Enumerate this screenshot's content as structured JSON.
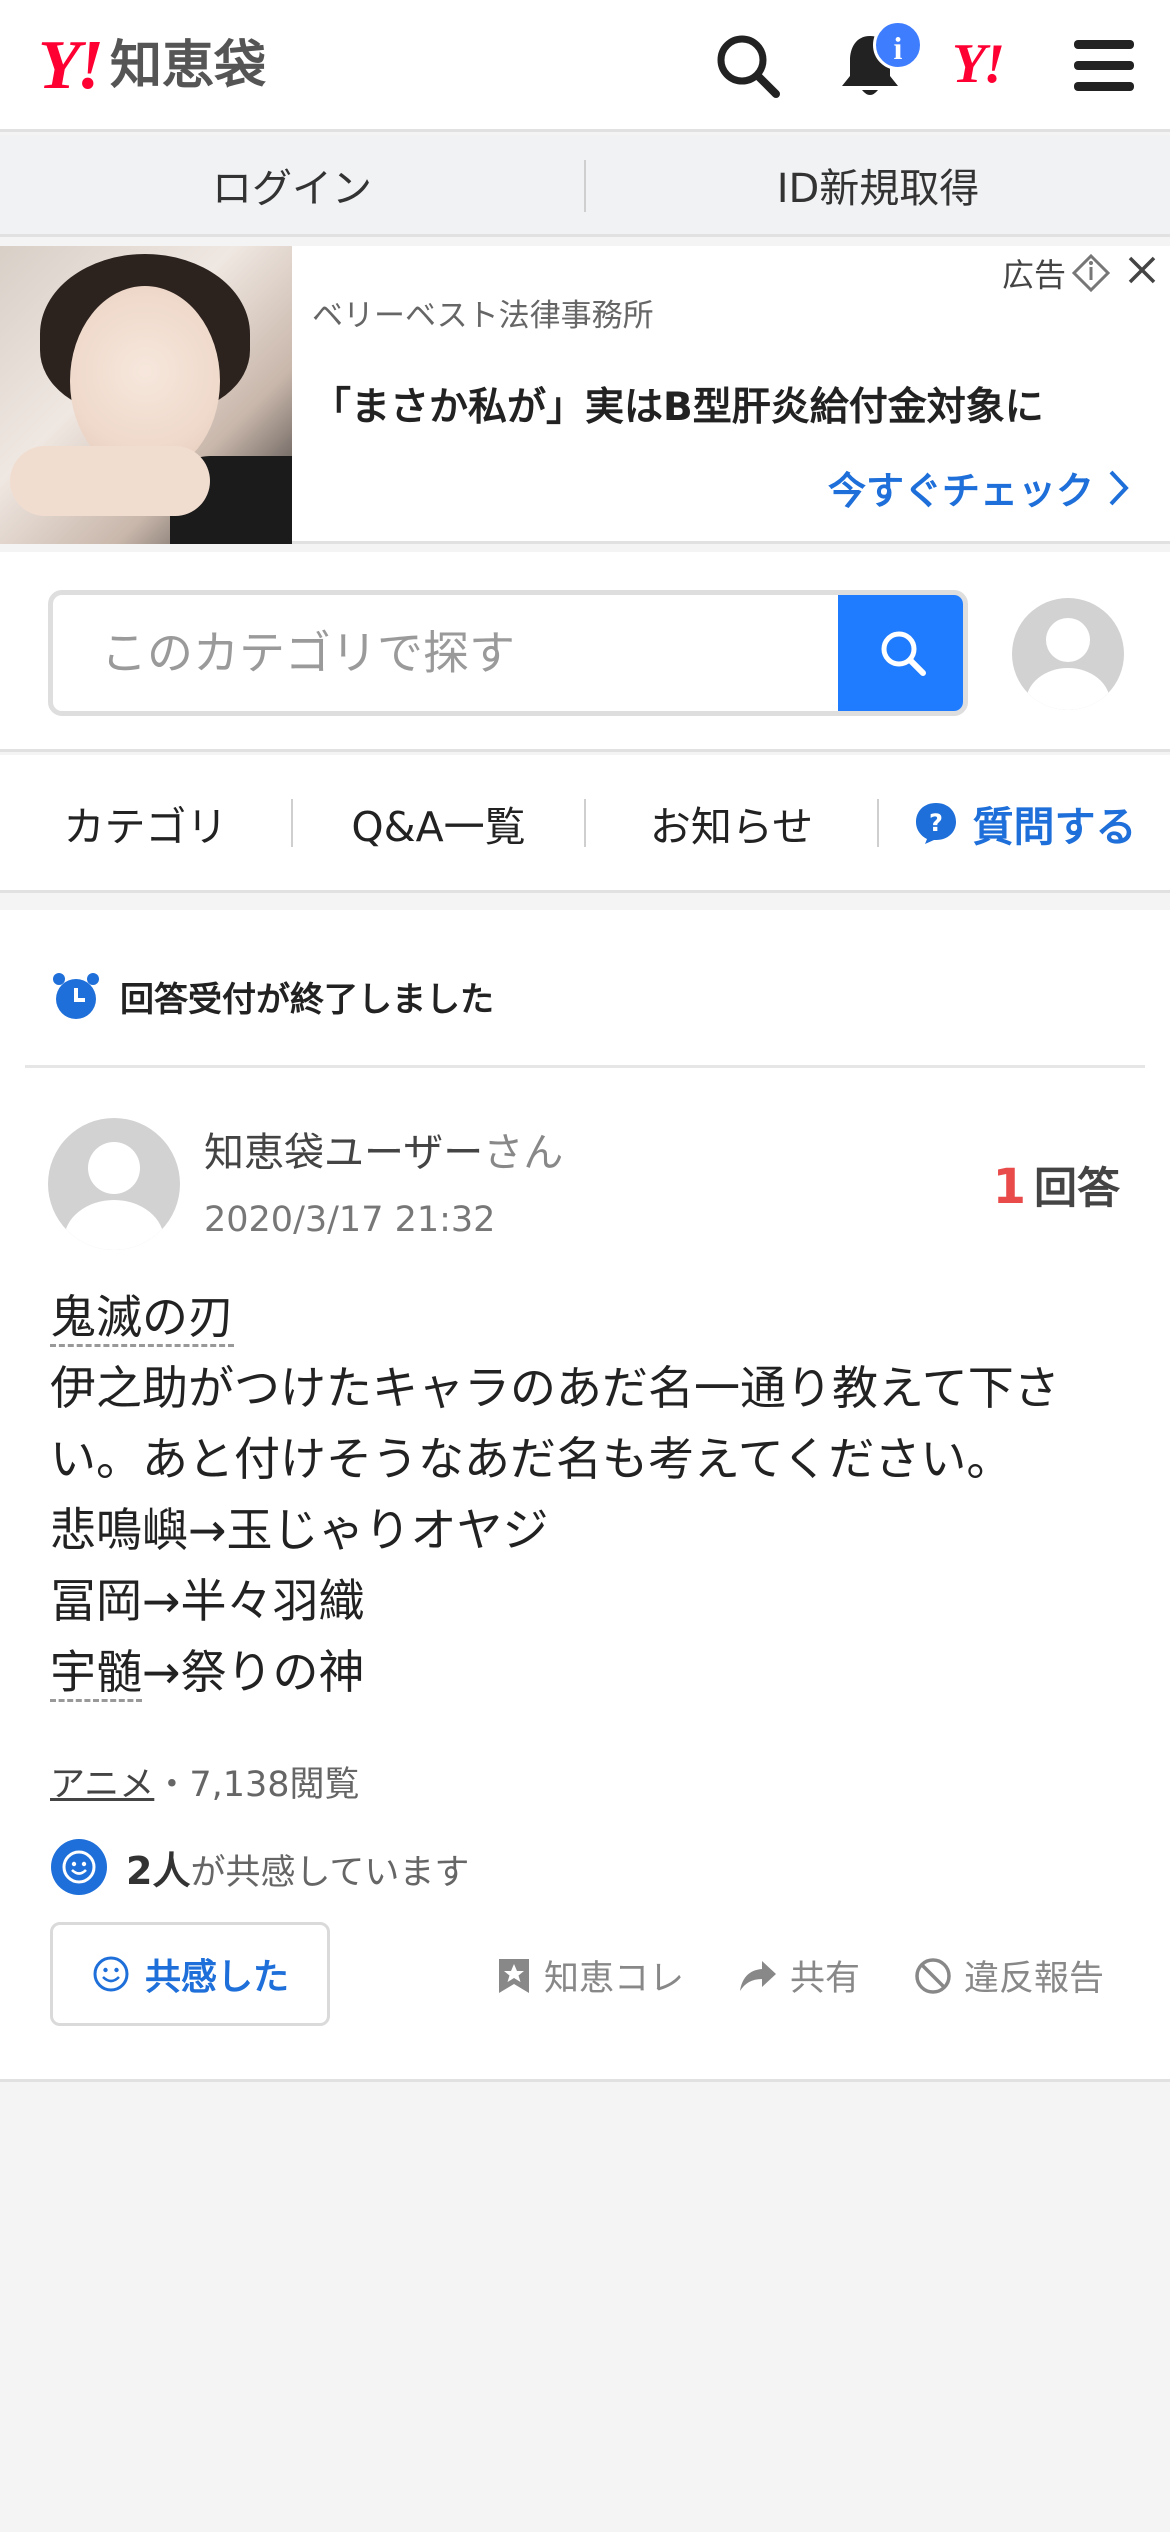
{
  "header": {
    "logo_y": "Y!",
    "logo_text": "知恵袋",
    "notification_count": "i",
    "yahoo_short": "Y!"
  },
  "loginbar": {
    "login": "ログイン",
    "signup": "ID新規取得"
  },
  "ad": {
    "label": "広告",
    "sponsor": "ベリーベスト法律事務所",
    "title": "「まさか私が」実はB型肝炎給付金対象に",
    "cta": "今すぐチェック"
  },
  "search": {
    "placeholder": "このカテゴリで探す"
  },
  "tabs": {
    "category": "カテゴリ",
    "qa_list": "Q&A一覧",
    "news": "お知らせ",
    "ask": "質問する"
  },
  "question": {
    "closed_notice": "回答受付が終了しました",
    "user": "知恵袋ユーザー",
    "user_suffix": "さん",
    "date": "2020/3/17 21:32",
    "answer_count": "1",
    "answer_label": "回答",
    "line1": "鬼滅の刃",
    "line2": "伊之助がつけたキャラのあだ名一通り教えて下さい。あと付けそうなあだ名も考えてください。",
    "line3": "悲鳴嶼→玉じゃりオヤジ",
    "line4": "冨岡→半々羽織",
    "line5_a": "宇髄",
    "line5_b": "→祭りの神",
    "category": "アニメ",
    "views": "・7,138閲覧",
    "empathy_count": "2人",
    "empathy_text": "が共感しています",
    "empathy_button": "共感した",
    "actions": {
      "save": "知恵コレ",
      "share": "共有",
      "report": "違反報告"
    }
  },
  "colors": {
    "brand_red": "#ff0033",
    "accent_blue": "#1f7cff",
    "answer_red": "#e94b4b"
  }
}
